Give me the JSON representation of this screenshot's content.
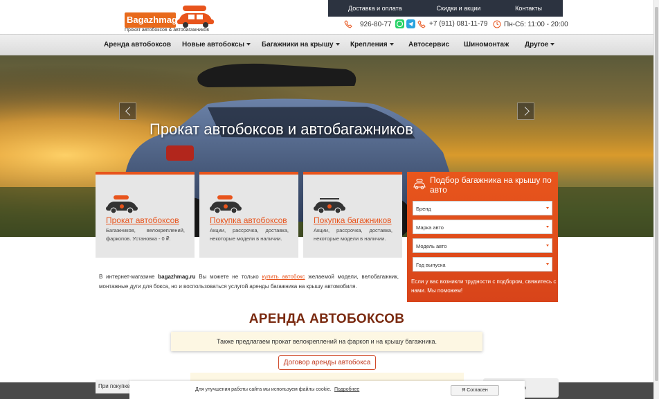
{
  "topbar": {
    "links": [
      "Доставка и оплата",
      "Скидки и акции",
      "Контакты"
    ]
  },
  "logo": {
    "name": "Bagazhmag",
    "tagline": "Прокат автобоксов & автобагажников"
  },
  "contacts": {
    "phone1": "926-80-77",
    "phone2": "+7 (911) 081-11-79",
    "hours": "Пн-Сб: 11:00 - 20:00"
  },
  "nav": {
    "items": [
      {
        "label": "Аренда автобоксов",
        "dropdown": false
      },
      {
        "label": "Новые автобоксы",
        "dropdown": true
      },
      {
        "label": "Багажники на крышу",
        "dropdown": true
      },
      {
        "label": "Крепления",
        "dropdown": true
      },
      {
        "label": "Автосервис",
        "dropdown": false
      },
      {
        "label": "Шиномонтаж",
        "dropdown": false
      },
      {
        "label": "Другое",
        "dropdown": true
      }
    ]
  },
  "hero": {
    "title": "Прокат автобоксов и автобагажников"
  },
  "cards": [
    {
      "title": "Прокат автобоксов",
      "text": "Багажников, велокреплений, фаркопов. Установка - 0 ₽."
    },
    {
      "title": "Покупка автобоксов",
      "text": "Акции, рассрочка, доставка, некоторые модели в наличии."
    },
    {
      "title": "Покупка багажников",
      "text": "Акции, рассрочка, доставка, некоторые модели в наличии."
    }
  ],
  "sideform": {
    "title": "Подбор багажника на крышу по авто",
    "selects": [
      "Бренд",
      "Марка авто",
      "Модель авто",
      "Год выпуска"
    ],
    "help": "Если у вас возникли трудности с подбором, свяжитесь с нами. Мы поможем!"
  },
  "intro": {
    "p1": "В интернет-магазине ",
    "site": "bagazhmag.ru",
    "p2": " Вы можете не только ",
    "link": "купить автобокс",
    "p3": " желаемой модели, велобагажник, монтажные дуги для бокса, но и воспользоваться услугой аренды багажника на крышу автомобиля."
  },
  "section": {
    "title": "АРЕНДА АВТОБОКСОВ",
    "promo": "Также предлагаем прокат велокреплений на фаркоп и на крышу багажника.",
    "contract_button": "Договор аренды автобокса"
  },
  "bottom": {
    "left_tip": "При покупке",
    "right_tip": "а"
  },
  "cookie": {
    "text": "Для улучшения работы сайта мы используем файлы cookie.",
    "link": "Подробнее",
    "button": "Я Согласен"
  },
  "colors": {
    "accent": "#e8541c",
    "dark": "#2c3340",
    "heading": "#7a2a10"
  }
}
